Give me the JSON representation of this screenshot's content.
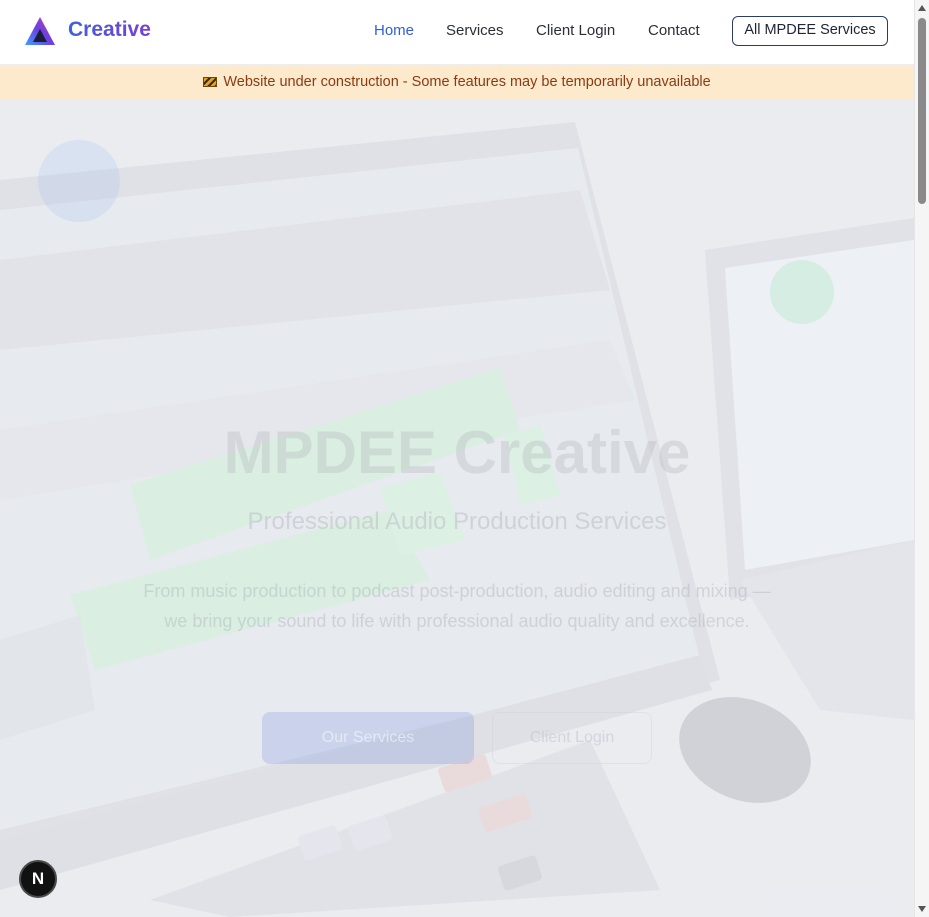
{
  "header": {
    "brand": "Creative",
    "nav": [
      {
        "label": "Home",
        "active": true
      },
      {
        "label": "Services",
        "active": false
      },
      {
        "label": "Client Login",
        "active": false
      },
      {
        "label": "Contact",
        "active": false
      }
    ],
    "cta": "All MPDEE Services"
  },
  "banner": {
    "icon": "construction-barrier-icon",
    "text": "Website under construction - Some features may be temporarily unavailable"
  },
  "hero": {
    "title": "MPDEE Creative",
    "subtitle": "Professional Audio Production Services",
    "description": "From music production to podcast post-production, audio editing and mixing — we bring your sound to life with professional audio quality and excellence.",
    "primary_button": "Our Services",
    "secondary_button": "Client Login",
    "background_image": "desk-setup-audio-editing-monitor-laptop-keyboard-mouse"
  },
  "dev_badge": {
    "label": "N",
    "icon": "nextjs-icon"
  },
  "colors": {
    "accent": "#2f5fd6",
    "banner_bg": "#fde9cb",
    "banner_text": "#8a3b12",
    "brand_gradient_start": "#3f5fe0",
    "brand_gradient_end": "#7b3fd4"
  }
}
